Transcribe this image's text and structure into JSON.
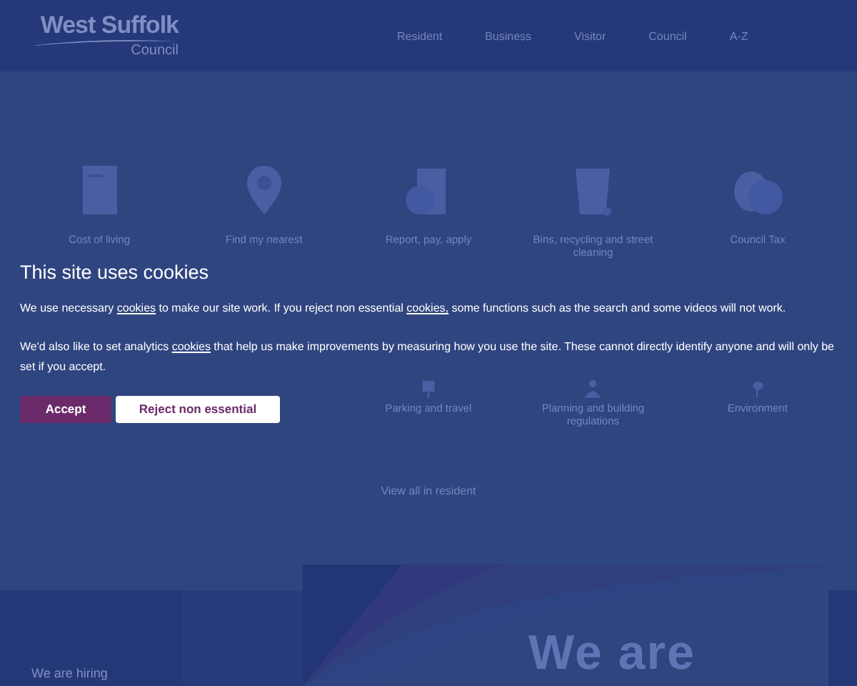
{
  "header": {
    "logo": "West Suffolk",
    "logo_sub": "Council",
    "nav": [
      "Resident",
      "Business",
      "Visitor",
      "Council",
      "A-Z"
    ]
  },
  "tiles": [
    {
      "label": "Cost of living"
    },
    {
      "label": "Find my nearest"
    },
    {
      "label": "Report, pay, apply"
    },
    {
      "label": "Bins, recycling and street cleaning"
    },
    {
      "label": "Council Tax"
    }
  ],
  "tiles_row2": [
    {
      "label": "Parking and travel"
    },
    {
      "label": "Planning and building regulations"
    },
    {
      "label": "Environment"
    }
  ],
  "view_all": "View all in resident",
  "promo": {
    "text": "We are hiring"
  },
  "hero": {
    "heading": "We are"
  },
  "cookie_banner": {
    "title": "This site uses cookies",
    "paragraphs": [
      [
        {
          "text": "We use necessary "
        },
        {
          "text": "cookies",
          "link": true
        },
        {
          "text": " to make our site work. If you reject non essential "
        },
        {
          "text": "cookies,",
          "link": true
        },
        {
          "text": " some functions such as the search and some videos will not work."
        }
      ],
      [
        {
          "text": "We'd also like to set analytics "
        },
        {
          "text": "cookies",
          "link": true
        },
        {
          "text": " that help us make improvements by measuring how you use the site. These cannot directly identify anyone and will only be set if you accept."
        }
      ]
    ],
    "buttons": [
      {
        "label": "Accept",
        "kind": "primary"
      },
      {
        "label": "Reject non essential",
        "kind": "secondary"
      }
    ]
  }
}
